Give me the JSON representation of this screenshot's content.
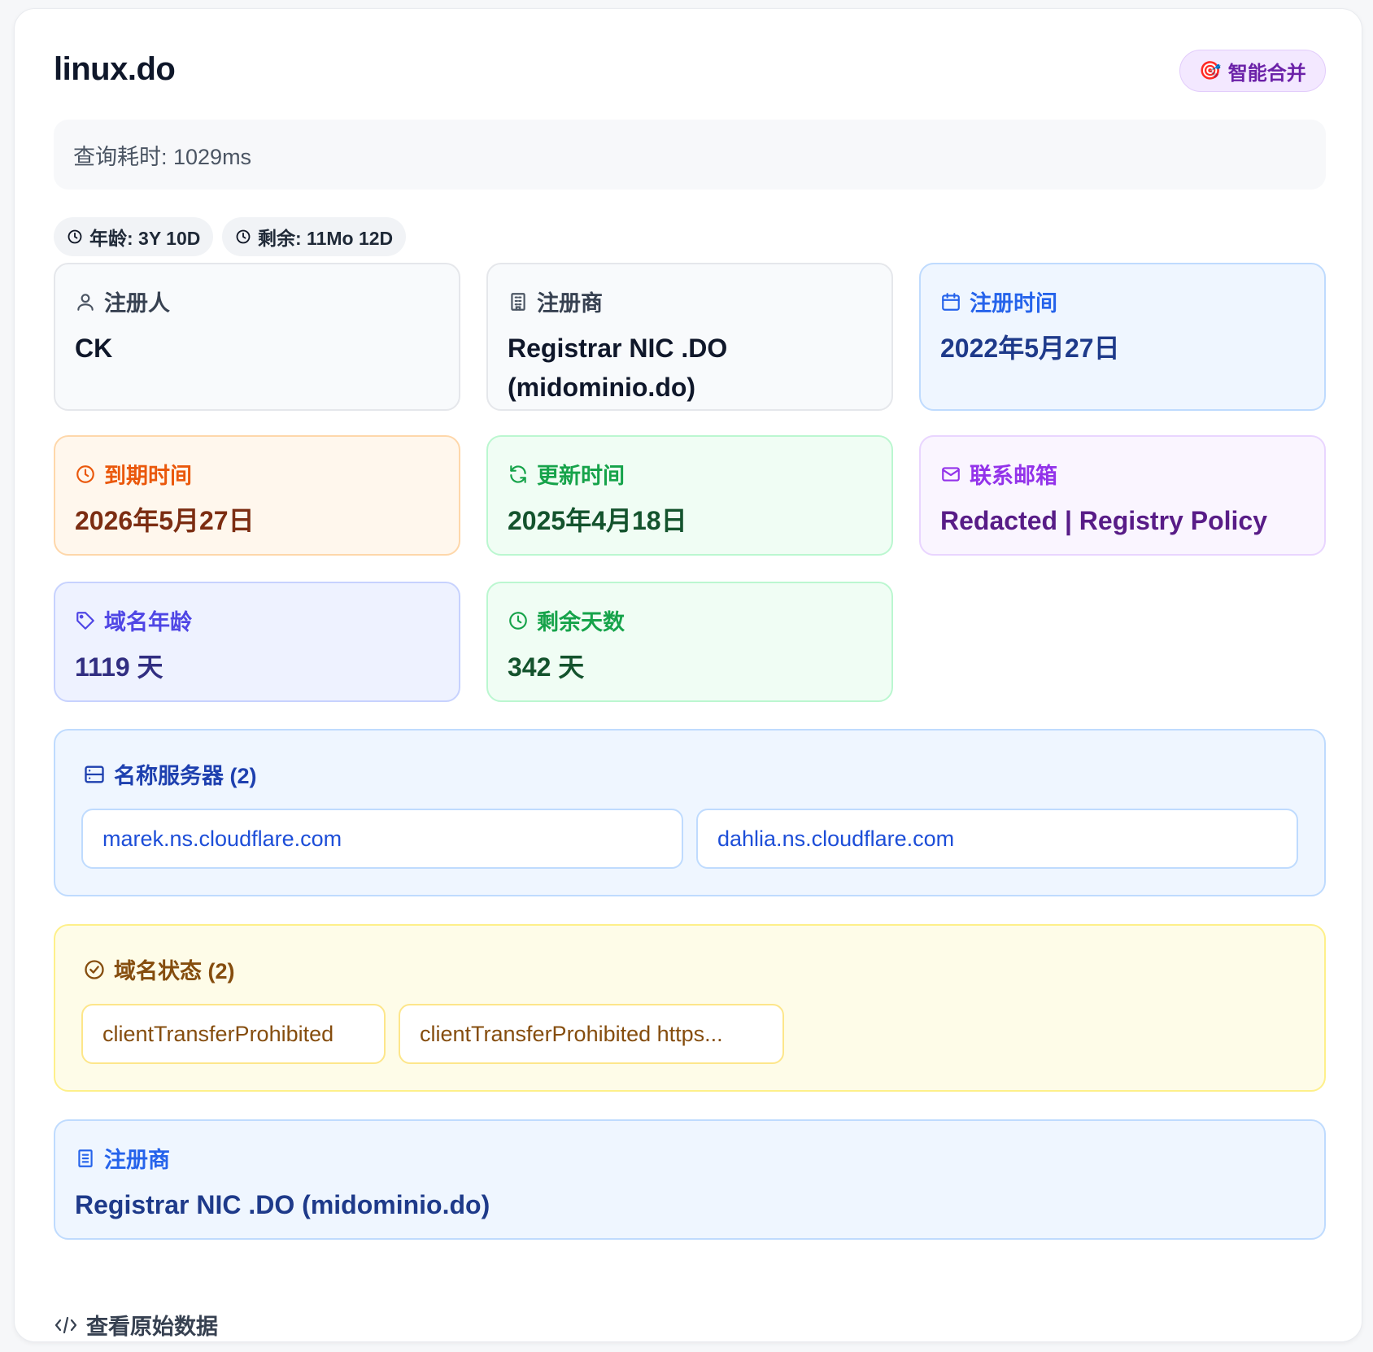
{
  "domain": "linux.do",
  "smart_merge": {
    "icon": "🎯",
    "label": "智能合并"
  },
  "query_time": "查询耗时: 1029ms",
  "chips": [
    {
      "label": "年龄: 3Y 10D"
    },
    {
      "label": "剩余: 11Mo 12D"
    }
  ],
  "cards": {
    "registrant": {
      "label": "注册人",
      "value": "CK"
    },
    "registrar": {
      "label": "注册商",
      "value_line1": "Registrar NIC .DO",
      "value_line2": "(midominio.do)"
    },
    "registered": {
      "label": "注册时间",
      "value": "2022年5月27日"
    },
    "expires": {
      "label": "到期时间",
      "value": "2026年5月27日"
    },
    "updated": {
      "label": "更新时间",
      "value": "2025年4月18日"
    },
    "email": {
      "label": "联系邮箱",
      "value": "Redacted | Registry Policy"
    },
    "age": {
      "label": "域名年龄",
      "value": "1119 天"
    },
    "remaining": {
      "label": "剩余天数",
      "value": "342 天"
    }
  },
  "nameservers": {
    "label": "名称服务器 (2)",
    "items": [
      "marek.ns.cloudflare.com",
      "dahlia.ns.cloudflare.com"
    ]
  },
  "status": {
    "label": "域名状态 (2)",
    "items": [
      "clientTransferProhibited",
      "clientTransferProhibited https..."
    ]
  },
  "registrar_block": {
    "label": "注册商",
    "value": "Registrar NIC .DO (midominio.do)"
  },
  "raw_data": {
    "label": "查看原始数据"
  },
  "colors": {
    "gray_card_bg": "#f8fafc",
    "gray_card_border": "#e5e7eb",
    "blue_bg": "#eff6ff",
    "blue_border": "#bfdbfe",
    "blue_text": "#1e3a8a",
    "blue_label": "#2563eb",
    "orange_bg": "#fff7ed",
    "orange_border": "#fed7aa",
    "orange_text": "#7c2d12",
    "orange_label": "#ea580c",
    "green_bg": "#f0fdf4",
    "green_border": "#bbf7d0",
    "green_text": "#14532d",
    "green_label": "#16a34a",
    "purple_bg": "#faf5ff",
    "purple_border": "#e9d5ff",
    "purple_text": "#581c87",
    "purple_label": "#9333ea",
    "indigo_bg": "#eef2ff",
    "indigo_border": "#c7d2fe",
    "indigo_text": "#312e81",
    "indigo_label": "#4f46e5",
    "yellow_bg": "#fefce8",
    "yellow_border": "#fef08a",
    "yellow_text": "#854d0e"
  }
}
